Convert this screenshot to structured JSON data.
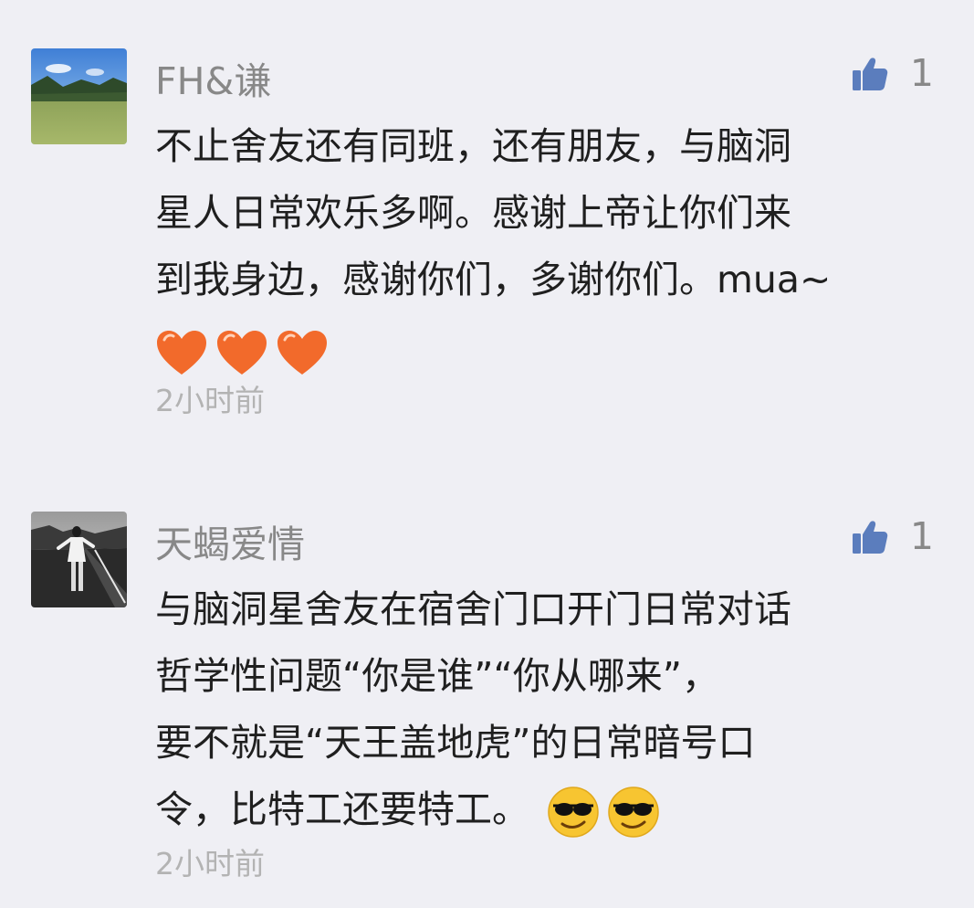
{
  "comments": [
    {
      "username": "FH&谦",
      "like_count": "1",
      "lines": [
        "不止舍友还有同班，还有朋友，与脑洞",
        "星人日常欢乐多啊。感谢上帝让你们来",
        "到我身边，感谢你们，多谢你们。mua~"
      ],
      "emoji": [
        "heart-emoji",
        "heart-emoji",
        "heart-emoji"
      ],
      "timestamp": "2小时前",
      "avatar": "landscape-photo"
    },
    {
      "username": "天蝎爱情",
      "like_count": "1",
      "lines": [
        "与脑洞星舍友在宿舍门口开门日常对话",
        "哲学性问题“你是谁”“你从哪来”，",
        "要不就是“天王盖地虎”的日常暗号口",
        "令，比特工还要特工。"
      ],
      "emoji": [
        "sunglasses-emoji",
        "sunglasses-emoji"
      ],
      "timestamp": "2小时前",
      "avatar": "road-figure-photo"
    }
  ],
  "colors": {
    "background": "#efeff4",
    "username": "#888888",
    "body_text": "#1f1f1f",
    "timestamp": "#b3b3b3",
    "like_icon": "#5b7dbd"
  }
}
